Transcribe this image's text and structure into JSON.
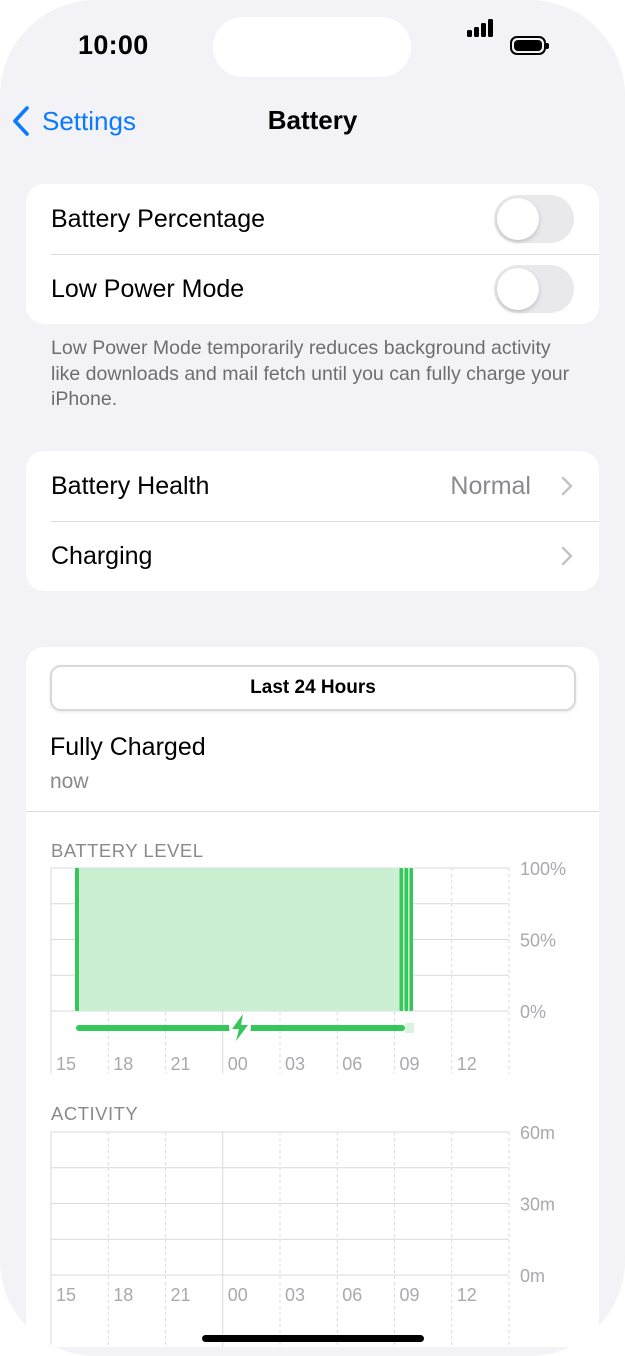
{
  "status_bar": {
    "time": "10:00"
  },
  "nav": {
    "back_label": "Settings",
    "title": "Battery"
  },
  "toggles": [
    {
      "label": "Battery Percentage",
      "on": false
    },
    {
      "label": "Low Power Mode",
      "on": false
    }
  ],
  "footnote": "Low Power Mode temporarily reduces background activity like downloads and mail fetch until you can fully charge your iPhone.",
  "health": {
    "battery_health_label": "Battery Health",
    "battery_health_value": "Normal",
    "charging_label": "Charging"
  },
  "usage": {
    "segment_label": "Last 24 Hours",
    "status_title": "Fully Charged",
    "status_sub": "now"
  },
  "chart_data": [
    {
      "type": "area",
      "title": "BATTERY LEVEL",
      "x_ticks": [
        "15",
        "18",
        "21",
        "00",
        "03",
        "06",
        "09",
        "12"
      ],
      "y_ticks": [
        "100%",
        "50%",
        "0%"
      ],
      "ylim": [
        0,
        100
      ],
      "series": [
        {
          "values": [
            100,
            100,
            100,
            100,
            100,
            100,
            100,
            100,
            100,
            100,
            100,
            100,
            100,
            100,
            100,
            100,
            100,
            100,
            100
          ]
        }
      ],
      "charging": true,
      "colors": {
        "fill": "#cbefd2",
        "line": "#34c759",
        "grid": "#d9d9de"
      }
    },
    {
      "type": "bar",
      "title": "ACTIVITY",
      "x_ticks": [
        "15",
        "18",
        "21",
        "00",
        "03",
        "06",
        "09",
        "12"
      ],
      "y_ticks": [
        "60m",
        "30m",
        "0m"
      ],
      "ylim": [
        0,
        60
      ],
      "series": [
        {
          "values": [
            0,
            0,
            0,
            0,
            0,
            0,
            0,
            0,
            0,
            0,
            0,
            0,
            0,
            0,
            0,
            0,
            0,
            0,
            0,
            0,
            0,
            0,
            0,
            0
          ]
        }
      ]
    }
  ],
  "colors": {
    "accent": "#0a7aff",
    "background": "#f2f2f7",
    "green": "#34c759"
  }
}
